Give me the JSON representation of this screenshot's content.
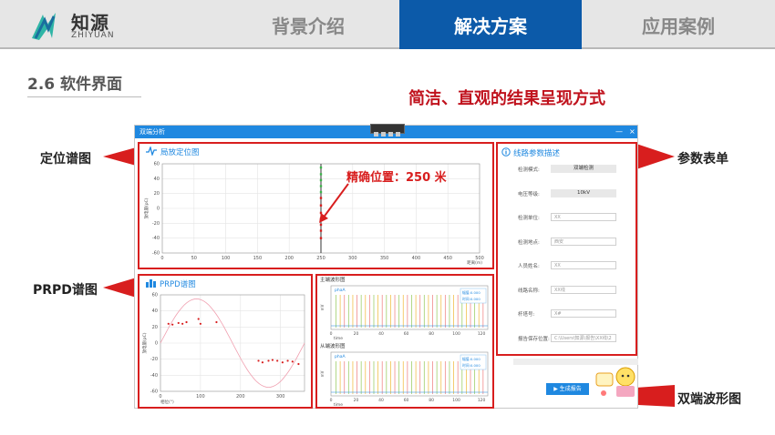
{
  "logo": {
    "cn": "知源",
    "en": "ZHIYUAN"
  },
  "nav": {
    "tabs": [
      {
        "label": "背景介绍"
      },
      {
        "label": "解决方案"
      },
      {
        "label": "应用案例"
      }
    ],
    "active_index": 1
  },
  "section": {
    "title": "2.6 软件界面"
  },
  "slogan": "简洁、直观的结果呈现方式",
  "callouts": {
    "locate": "定位谱图",
    "prpd": "PRPD谱图",
    "params": "参数表单",
    "waveform": "双端波形图"
  },
  "colors": {
    "brand": "#0c5aa9",
    "accent_red": "#d81e1e",
    "window_blue": "#1f88e0"
  },
  "window": {
    "title": "双端分析",
    "minimize": "—",
    "close": "×",
    "locate_panel": {
      "title": "局放定位图",
      "annotation": "精确位置：250 米",
      "ylabel": "放电量(pC)",
      "xlabel": "距离(m)",
      "x_ticks": [
        "0",
        "50",
        "100",
        "150",
        "200",
        "250",
        "300",
        "350",
        "400",
        "450",
        "500"
      ],
      "y_ticks": [
        "60",
        "40",
        "20",
        "0",
        "-20",
        "-40",
        "-60"
      ]
    },
    "prpd_panel": {
      "title": "PRPD谱图",
      "ylabel": "放电量(pC)",
      "xlabel": "相位(°)",
      "x_ticks": [
        "0",
        "100",
        "200",
        "300"
      ],
      "y_ticks": [
        "60",
        "40",
        "20",
        "0",
        "-20",
        "-40",
        "-60"
      ]
    },
    "wave_panel": {
      "top_label": "主端波形图",
      "bottom_label": "从端波形图",
      "legend_label": "phaA",
      "top_info": [
        "幅值:0.000",
        "时间:0.000"
      ],
      "bottom_info": [
        "幅值:0.000",
        "时间:0.000"
      ],
      "ylabel": "mV",
      "xlabel": "time",
      "x_ticks": [
        "0",
        "20",
        "40",
        "60",
        "80",
        "100",
        "120"
      ]
    },
    "params": {
      "title": "线路参数描述",
      "fields": [
        {
          "label": "检测模式:",
          "value": "双端检测",
          "kind": "select"
        },
        {
          "label": "电压等级:",
          "value": "10kV",
          "kind": "select"
        },
        {
          "label": "检测单位:",
          "value": "XX",
          "kind": "input"
        },
        {
          "label": "检测地点:",
          "value": "西安",
          "kind": "input"
        },
        {
          "label": "人员姓名:",
          "value": "XX",
          "kind": "input"
        },
        {
          "label": "线路名称:",
          "value": "XX线",
          "kind": "input"
        },
        {
          "label": "杆塔号:",
          "value": "X#",
          "kind": "input"
        },
        {
          "label": "报告保存位置:",
          "value": "C:\\Users\\知源\\报告\\XX线\\2",
          "kind": "input"
        }
      ],
      "generate_button": "生成报告"
    }
  },
  "chart_data": [
    {
      "type": "scatter",
      "title": "局放定位图",
      "xlabel": "距离(m)",
      "ylabel": "放电量(pC)",
      "xlim": [
        0,
        500
      ],
      "ylim": [
        -60,
        60
      ],
      "series": [
        {
          "values": [
            [
              250,
              -40
            ],
            [
              250,
              -30
            ],
            [
              250,
              -22
            ],
            [
              250,
              -14
            ],
            [
              250,
              -6
            ],
            [
              250,
              4
            ],
            [
              250,
              14
            ],
            [
              250,
              22
            ],
            [
              250,
              30
            ],
            [
              250,
              38
            ],
            [
              250,
              46
            ],
            [
              250,
              55
            ]
          ]
        }
      ],
      "marker_x": 250
    },
    {
      "type": "scatter",
      "title": "PRPD谱图",
      "xlabel": "相位(°)",
      "ylabel": "放电量(pC)",
      "xlim": [
        0,
        360
      ],
      "ylim": [
        -60,
        60
      ],
      "series": [
        {
          "values": [
            [
              20,
              24
            ],
            [
              30,
              23
            ],
            [
              45,
              25
            ],
            [
              55,
              24
            ],
            [
              65,
              26
            ],
            [
              95,
              30
            ],
            [
              100,
              24
            ],
            [
              140,
              26
            ],
            [
              245,
              -22
            ],
            [
              255,
              -24
            ],
            [
              270,
              -22
            ],
            [
              280,
              -21
            ],
            [
              292,
              -22
            ],
            [
              305,
              -24
            ],
            [
              318,
              -22
            ],
            [
              330,
              -23
            ],
            [
              345,
              -26
            ]
          ]
        }
      ],
      "reference_curve": "sine"
    }
  ]
}
